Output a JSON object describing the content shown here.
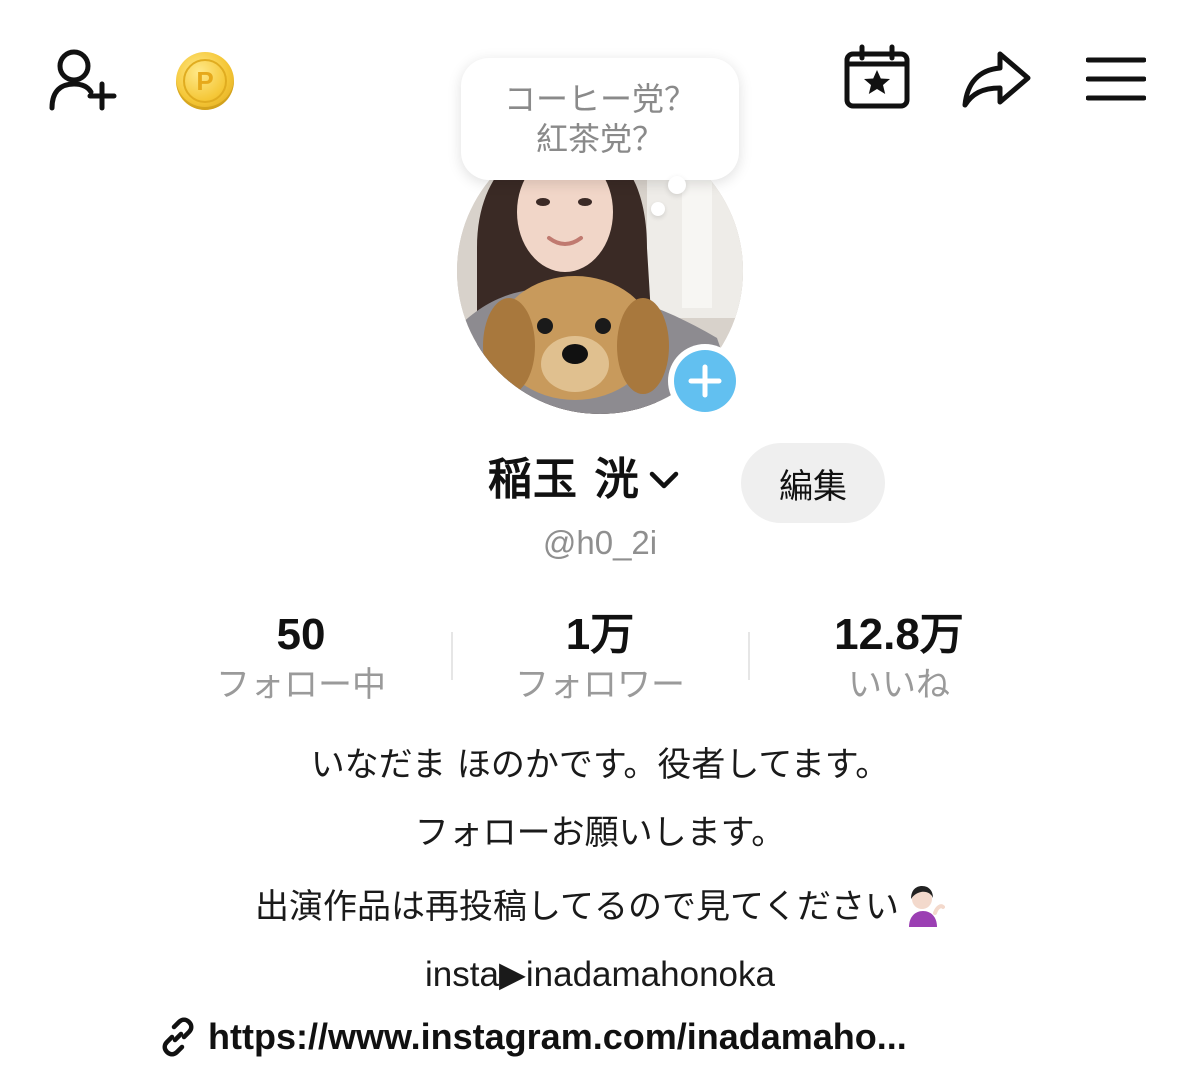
{
  "topbar": {
    "add_friend_icon": "person-plus-icon",
    "coin_letter": "P",
    "calendar_icon": "calendar-star-icon",
    "share_icon": "share-arrow-icon",
    "menu_icon": "hamburger-menu-icon"
  },
  "bubble": {
    "line1": "コーヒー党？",
    "line2": "紅茶党？"
  },
  "profile": {
    "name": "稲玉 洸",
    "handle": "@h0_2i",
    "edit_label": "編集"
  },
  "stats": [
    {
      "value": "50",
      "label": "フォロー中"
    },
    {
      "value": "1万",
      "label": "フォロワー"
    },
    {
      "value": "12.8万",
      "label": "いいね"
    }
  ],
  "bio": {
    "line1": "いなだま ほのかです。役者してます。",
    "line2": "フォローお願いします。",
    "line3": "出演作品は再投稿してるので見てください",
    "insta": "insta▶inadamahonoka",
    "link": "https://www.instagram.com/inadamaho..."
  },
  "colors": {
    "accent_blue": "#62c0f0",
    "coin_gold": "#f5c737",
    "muted_text": "#9a9a9a"
  }
}
